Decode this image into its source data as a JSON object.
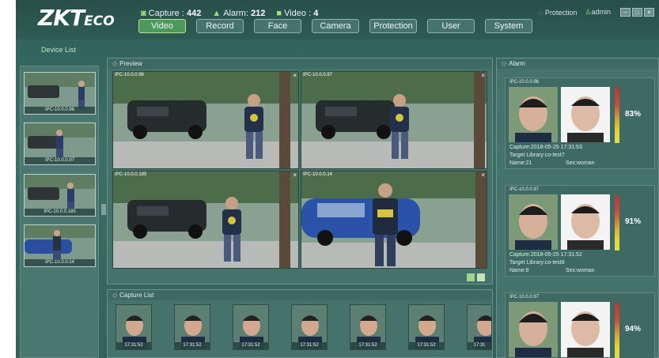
{
  "header": {
    "logo": "ZKT",
    "logo_suffix": "ECO",
    "stats": [
      {
        "label": "Capture :",
        "value": "442",
        "icon": "camera-icon"
      },
      {
        "label": "Alarm:",
        "value": "212",
        "icon": "alarm-icon"
      },
      {
        "label": "Video :",
        "value": "4",
        "icon": "video-icon"
      }
    ],
    "protection_status": "Protection",
    "user": "admin",
    "tabs": [
      "Video",
      "Record",
      "Face",
      "Camera",
      "Protection",
      "User",
      "System"
    ],
    "active_tab": "Video"
  },
  "device_list": {
    "title": "Device List",
    "devices": [
      "IPC-10.0.0.96",
      "IPC-10.0.0.97",
      "IPC-10.0.0.185",
      "IPC-10.0.0.14"
    ]
  },
  "preview": {
    "title": "Preview",
    "videos": [
      {
        "label": "IPC-10.0.0.96"
      },
      {
        "label": "IPC-10.0.0.97"
      },
      {
        "label": "IPC-10.0.0.185"
      },
      {
        "label": "IPC-10.0.0.14"
      }
    ]
  },
  "capture_list": {
    "title": "Capture List",
    "items": [
      "17:31:52",
      "17:31:52",
      "17:31:52",
      "17:31:52",
      "17:31:52",
      "17:31:52",
      "17:31"
    ]
  },
  "alarm": {
    "title": "Alarm",
    "cards": [
      {
        "device": "IPC-10.0.0.96",
        "capture": "Capture:2018-05-25 17:31:53",
        "target": "Target Library:co-test7",
        "name": "Name:21",
        "sex": "Sex:woman",
        "score": "83%"
      },
      {
        "device": "IPC-10.0.0.97",
        "capture": "Capture:2018-05-25 17:31:52",
        "target": "Target Library:co-test8",
        "name": "Name:8",
        "sex": "Sex:woman",
        "score": "91%"
      },
      {
        "device": "IPC-10.0.0.97",
        "score": "94%"
      }
    ]
  },
  "colors": {
    "accent": "#4c9a5b",
    "background": "#3b6f68"
  }
}
